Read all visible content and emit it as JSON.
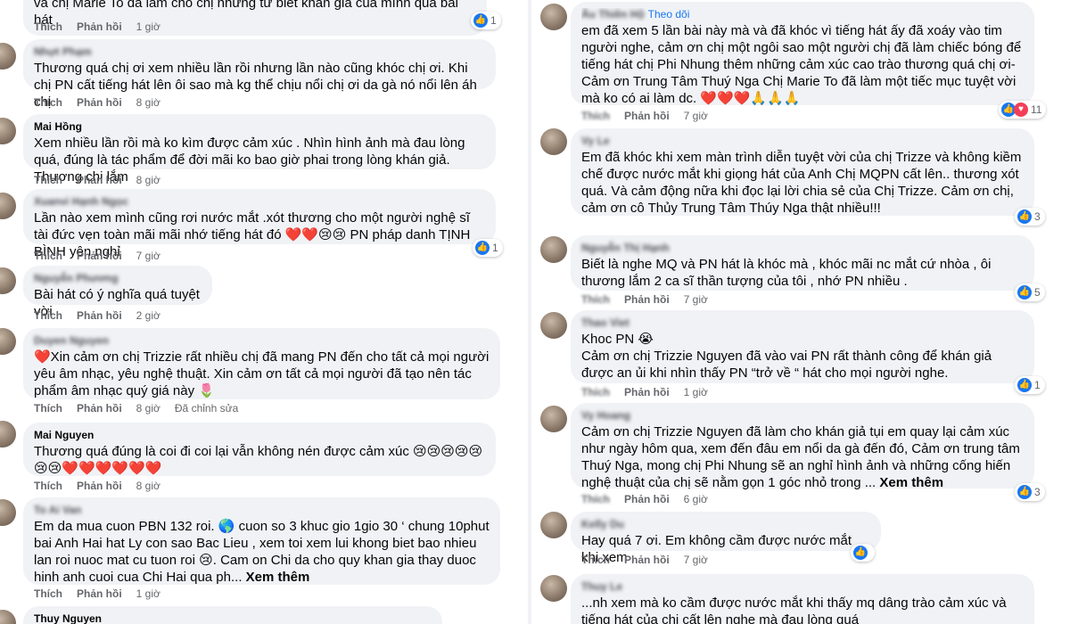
{
  "actions": {
    "like": "Thích",
    "reply": "Phản hồi",
    "edited": "Đã chỉnh sửa"
  },
  "left": [
    {
      "text": "và chị Marie To đã làm cho chị nhưng từ biết khán giả của mình qua bài hát",
      "time": "1 giờ",
      "reactions": "1"
    },
    {
      "name": "Nhựt Phạm",
      "text": "Thương quá chị ơi xem nhiều lần rồi nhưng lần nào cũng khóc chị ơi. Khi chị PN cất tiếng hát lên ôi sao mà kg thể chịu nổi chị ơi da gà nó nổi lên áh chị",
      "time": "8 giờ"
    },
    {
      "name": "Mai Hồng",
      "text": "Xem nhiều lần rồi mà ko kìm được cảm xúc . Nhìn hình ảnh mà đau lòng quá, đúng là tác phẩm để đời mãi ko bao giờ phai trong lòng khán giả. Thương chị lắm",
      "time": "8 giờ"
    },
    {
      "name": "Xuanvi Hạnh Ngọc",
      "text": "Lần nào xem mình cũng rơi nước mắt .xót thương cho một người nghệ sĩ tài đức vẹn toàn mãi mãi nhớ tiếng hát đó ❤️❤️😢😢 PN pháp danh TỊNH BÌNH yên nghỉ",
      "time": "7 giờ",
      "reactions": "1"
    },
    {
      "name": "Nguyễn Phương",
      "text": "Bài hát có ý nghĩa quá tuyệt vời",
      "time": "2 giờ"
    },
    {
      "name": "Duyen Nguyen",
      "text": "❤️Xin cảm ơn chị Trizzie rất nhiều chị đã mang PN đến cho tất cả mọi người yêu âm nhạc, yêu nghệ thuật. Xin cảm ơn tất cả mọi người đã tạo nên tác phẩm âm nhạc quý giá này 🌷",
      "time": "8 giờ"
    },
    {
      "name": "Mai Nguyen",
      "text": "Thương quá đúng là coi đi coi lại vẫn không nén được cảm xúc 😢😢😢😢😢😢😢❤️❤️❤️❤️❤️❤️",
      "time": "8 giờ"
    },
    {
      "name": "To Ai Van",
      "text": "Em da mua cuon PBN 132 roi. 🌎 cuon so 3 khuc gio 1gio 30 ‘ chung 10phut bai Anh Hai hat Ly con sao Bac Lieu , xem toi xem lui khong biet bao nhieu lan roi nuoc mat cu tuon roi 😢. Cam on Chi da cho quy khan gia thay duoc hinh anh cuoi cua Chi Hai qua ph...",
      "see_more": "Xem thêm",
      "time": "1 giờ"
    },
    {
      "name": "Thuy Nguyen"
    }
  ],
  "right": [
    {
      "name": "Âu Thiên Hộ",
      "follow": "Theo dõi",
      "text": "em đã xem 5 lần bài này mà và đã khóc vì tiếng hát ấy đã xoáy vào tim người nghe, cảm ơn chị một ngôi sao một người chị đã làm chiếc bóng để tiếng hát chị Phi Nhung thêm những cảm xúc cao trào thương quá chị ơi- Cảm ơn Trung Tâm Thuý Nga Chị Marie To đã làm một tiếc mục tuyệt vời mà ko có ai làm dc. ❤️❤️❤️🙏🙏🙏",
      "bold": "Marie To",
      "time": "7 giờ",
      "reactions": "11"
    },
    {
      "name": "Vy Le",
      "text": "Em đã khóc khi xem màn trình diễn tuyệt vời của chị Trizze và không kiềm chế được nước mắt khi giọng hát của Anh Chị MQPN cất lên.. thương xót quá. Và cảm động nữa khi đọc lại lời chia sẻ của Chị Trizze. Cảm ơn chị, cảm ơn cô Thủy Trung Tâm Thúy Nga thật nhiều!!!",
      "time": "",
      "reactions": "3"
    },
    {
      "name": "Nguyễn Thị Hạnh",
      "text": "Biết là nghe MQ và PN hát là khóc mà , khóc mãi nc mắt cứ nhòa , ôi thương lắm 2 ca sĩ thần tượng của tôi , nhớ PN nhiều .",
      "time": "7 giờ",
      "reactions": "5"
    },
    {
      "name": "Thao Viet",
      "text": "Khoc PN 😭\nCảm ơn chị Trizzie Nguyen đã vào vai PN rất thành công để khán giả được an ủi khi nhìn thấy PN “trở về “ hát cho mọi người nghe.",
      "time": "1 giờ",
      "reactions": "1"
    },
    {
      "name": "Vy Hoang",
      "text": "Cảm ơn chị Trizzie Nguyen đã làm cho khán giả tụi em quay lại cảm xúc như ngày hôm qua, xem đến đâu em nổi da gà đến đó, Cảm ơn trung tâm Thuý Nga, mong chị Phi Nhung sẽ an nghỉ hình ảnh và những cống hiến nghệ thuật của chị sẽ nằm gọn 1 góc nhỏ trong ...",
      "bold": "Trizzie Nguyen",
      "see_more": "Xem thêm",
      "time": "6 giờ",
      "reactions": "3"
    },
    {
      "name": "Kelly Du",
      "text": "Hay quá 7 ơi. Em không cầm được nước mắt khi xem .",
      "time": "7 giờ",
      "reactions": ""
    },
    {
      "name": "Thuy Le",
      "text": "...nh xem mà ko cầm được nước mắt khi thấy mq dâng trào cảm xúc và tiếng hát của chi cất lên nghe mà đau lòng quá"
    }
  ]
}
